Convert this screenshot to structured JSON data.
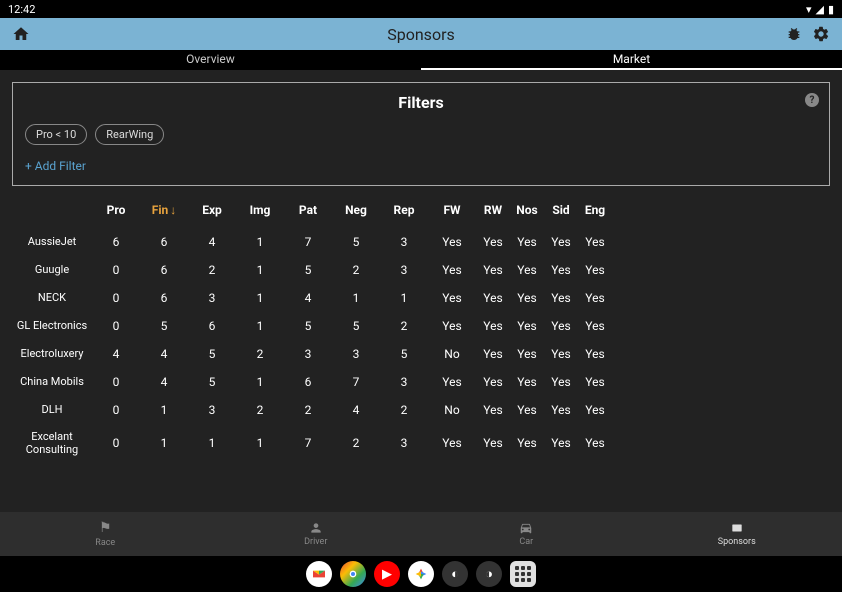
{
  "status": {
    "time": "12:42"
  },
  "appBar": {
    "title": "Sponsors"
  },
  "tabs": {
    "overview": "Overview",
    "market": "Market"
  },
  "filters": {
    "title": "Filters",
    "chips": [
      "Pro < 10",
      "RearWing"
    ],
    "addLabel": "+ Add Filter"
  },
  "columns": [
    "Pro",
    "Fin",
    "Exp",
    "Img",
    "Pat",
    "Neg",
    "Rep",
    "FW",
    "RW",
    "Nos",
    "Sid",
    "Eng"
  ],
  "sortedColumn": "Fin",
  "rows": [
    {
      "name": "AussieJet",
      "vals": [
        "6",
        "6",
        "4",
        "1",
        "7",
        "5",
        "3",
        "Yes",
        "Yes",
        "Yes",
        "Yes",
        "Yes"
      ]
    },
    {
      "name": "Guugle",
      "vals": [
        "0",
        "6",
        "2",
        "1",
        "5",
        "2",
        "3",
        "Yes",
        "Yes",
        "Yes",
        "Yes",
        "Yes"
      ]
    },
    {
      "name": "NECK",
      "vals": [
        "0",
        "6",
        "3",
        "1",
        "4",
        "1",
        "1",
        "Yes",
        "Yes",
        "Yes",
        "Yes",
        "Yes"
      ]
    },
    {
      "name": "GL Electronics",
      "vals": [
        "0",
        "5",
        "6",
        "1",
        "5",
        "5",
        "2",
        "Yes",
        "Yes",
        "Yes",
        "Yes",
        "Yes"
      ]
    },
    {
      "name": "Electroluxery",
      "vals": [
        "4",
        "4",
        "5",
        "2",
        "3",
        "3",
        "5",
        "No",
        "Yes",
        "Yes",
        "Yes",
        "Yes"
      ]
    },
    {
      "name": "China Mobils",
      "vals": [
        "0",
        "4",
        "5",
        "1",
        "6",
        "7",
        "3",
        "Yes",
        "Yes",
        "Yes",
        "Yes",
        "Yes"
      ]
    },
    {
      "name": "DLH",
      "vals": [
        "0",
        "1",
        "3",
        "2",
        "2",
        "4",
        "2",
        "No",
        "Yes",
        "Yes",
        "Yes",
        "Yes"
      ]
    },
    {
      "name": "Excelant Consulting",
      "vals": [
        "0",
        "1",
        "1",
        "1",
        "7",
        "2",
        "3",
        "Yes",
        "Yes",
        "Yes",
        "Yes",
        "Yes"
      ]
    }
  ],
  "bottomNav": {
    "race": "Race",
    "driver": "Driver",
    "car": "Car",
    "sponsors": "Sponsors"
  }
}
